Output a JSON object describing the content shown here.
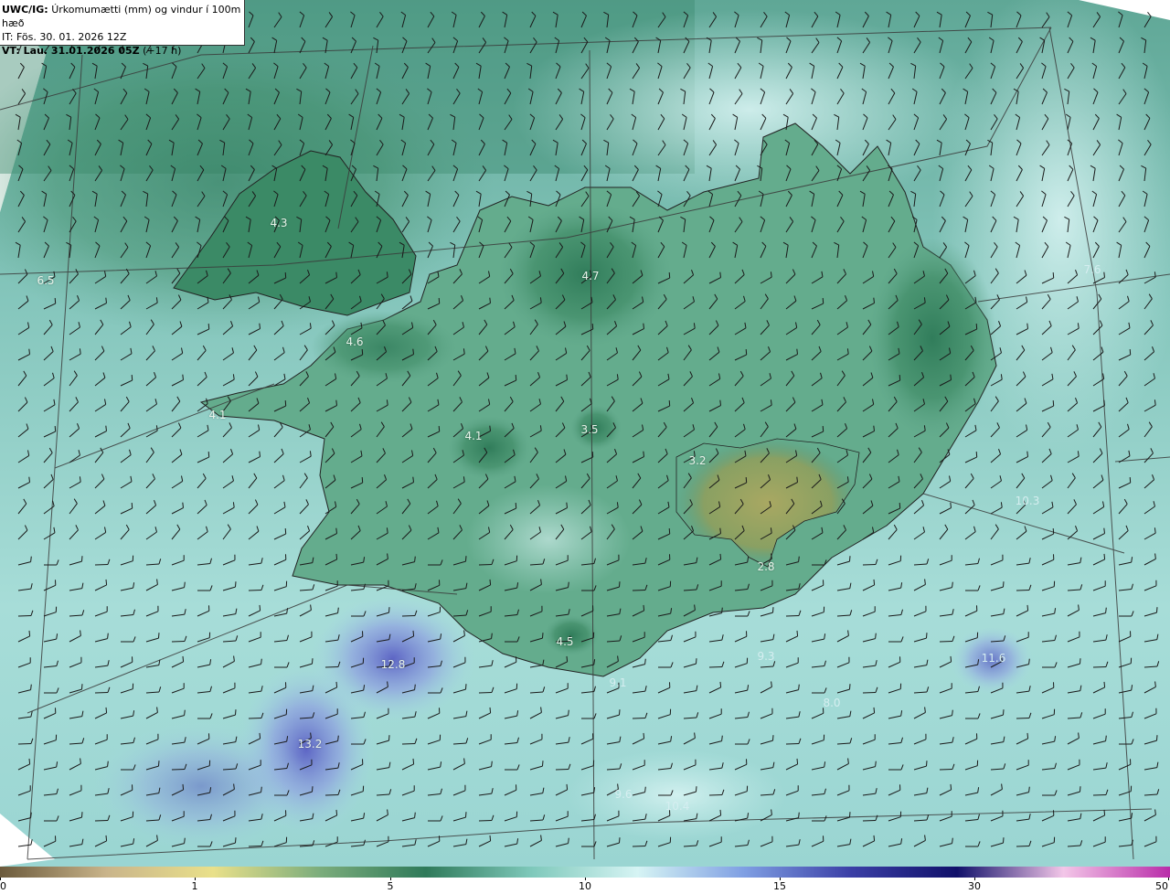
{
  "header": {
    "model_label": "UWC/IG:",
    "field_label": "Úrkomumætti (mm) og vindur í 100m hæð",
    "init_label": "IT: Fös. 30. 01. 2026 12Z",
    "valid_label": "VT: Lau. 31.01.2026 05Z",
    "lead_label": "(+17 h)"
  },
  "map_labels": [
    {
      "text": "4.3"
    },
    {
      "text": "6.5"
    },
    {
      "text": "4.6"
    },
    {
      "text": "4.1"
    },
    {
      "text": "4.1"
    },
    {
      "text": "3.5"
    },
    {
      "text": "4.7"
    },
    {
      "text": "3.2"
    },
    {
      "text": "2.8"
    },
    {
      "text": "4.5"
    },
    {
      "text": "12.8"
    },
    {
      "text": "13.2"
    },
    {
      "text": "7.6"
    },
    {
      "text": "10.3"
    },
    {
      "text": "9.3"
    },
    {
      "text": "11.6"
    },
    {
      "text": "8.0"
    },
    {
      "text": "9.1"
    },
    {
      "text": "10.4"
    },
    {
      "text": "9.6"
    }
  ],
  "colorbar": {
    "ticks": [
      "0",
      "1",
      "5",
      "10",
      "15",
      "30",
      "50"
    ],
    "colors": [
      "#6b5a3c",
      "#c9b48a",
      "#e9e08a",
      "#7cad7c",
      "#2f7a5a",
      "#7fc9bb",
      "#d6f4f4",
      "#7f9fe3",
      "#3b3fa6",
      "#10106a",
      "#f3c6e8",
      "#b92ca9"
    ]
  }
}
